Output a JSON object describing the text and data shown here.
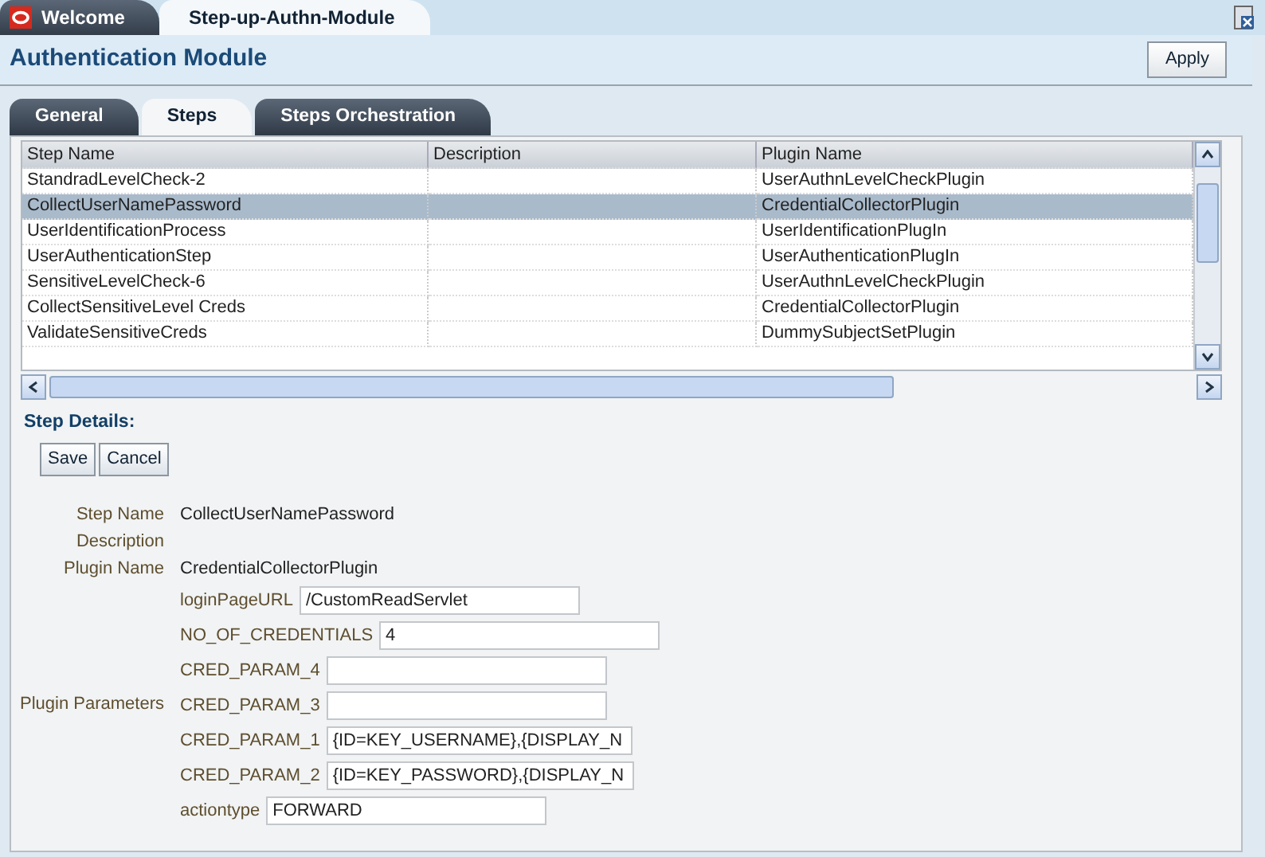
{
  "window_tabs": [
    {
      "label": "Welcome",
      "selected": false,
      "kind": "home"
    },
    {
      "label": "Step-up-Authn-Module",
      "selected": true,
      "kind": "page"
    }
  ],
  "page_title": "Authentication Module",
  "apply_button": "Apply",
  "tabs": [
    {
      "label": "General",
      "selected": false
    },
    {
      "label": "Steps",
      "selected": true
    },
    {
      "label": "Steps Orchestration",
      "selected": false
    }
  ],
  "table": {
    "columns": [
      "Step Name",
      "Description",
      "Plugin Name"
    ],
    "rows": [
      {
        "cells": [
          "StandradLevelCheck-2",
          "",
          "UserAuthnLevelCheckPlugin"
        ],
        "selected": false
      },
      {
        "cells": [
          "CollectUserNamePassword",
          "",
          "CredentialCollectorPlugin"
        ],
        "selected": true
      },
      {
        "cells": [
          "UserIdentificationProcess",
          "",
          "UserIdentificationPlugIn"
        ],
        "selected": false
      },
      {
        "cells": [
          "UserAuthenticationStep",
          "",
          "UserAuthenticationPlugIn"
        ],
        "selected": false
      },
      {
        "cells": [
          "SensitiveLevelCheck-6",
          "",
          "UserAuthnLevelCheckPlugin"
        ],
        "selected": false
      },
      {
        "cells": [
          "CollectSensitiveLevel Creds",
          "",
          "CredentialCollectorPlugin"
        ],
        "selected": false
      },
      {
        "cells": [
          "ValidateSensitiveCreds",
          "",
          "DummySubjectSetPlugin"
        ],
        "selected": false
      }
    ]
  },
  "details": {
    "title": "Step Details:",
    "buttons": [
      "Save",
      "Cancel"
    ],
    "fields": [
      {
        "label": "Step Name",
        "value": "CollectUserNamePassword"
      },
      {
        "label": "Description"
      },
      {
        "label": "Plugin Name",
        "value": "CredentialCollectorPlugin"
      }
    ],
    "plugin_parameters": {
      "label": "Plugin Parameters",
      "params": [
        {
          "label": "loginPageURL",
          "value": "/CustomReadServlet"
        },
        {
          "label": "NO_OF_CREDENTIALS",
          "value": "4"
        },
        {
          "label": "CRED_PARAM_4"
        },
        {
          "label": "CRED_PARAM_3"
        },
        {
          "label": "CRED_PARAM_1",
          "value": "{ID=KEY_USERNAME},{DISPLAY_N"
        },
        {
          "label": "CRED_PARAM_2",
          "value": "{ID=KEY_PASSWORD},{DISPLAY_N"
        },
        {
          "label": "actiontype",
          "value": "FORWARD"
        }
      ]
    }
  }
}
